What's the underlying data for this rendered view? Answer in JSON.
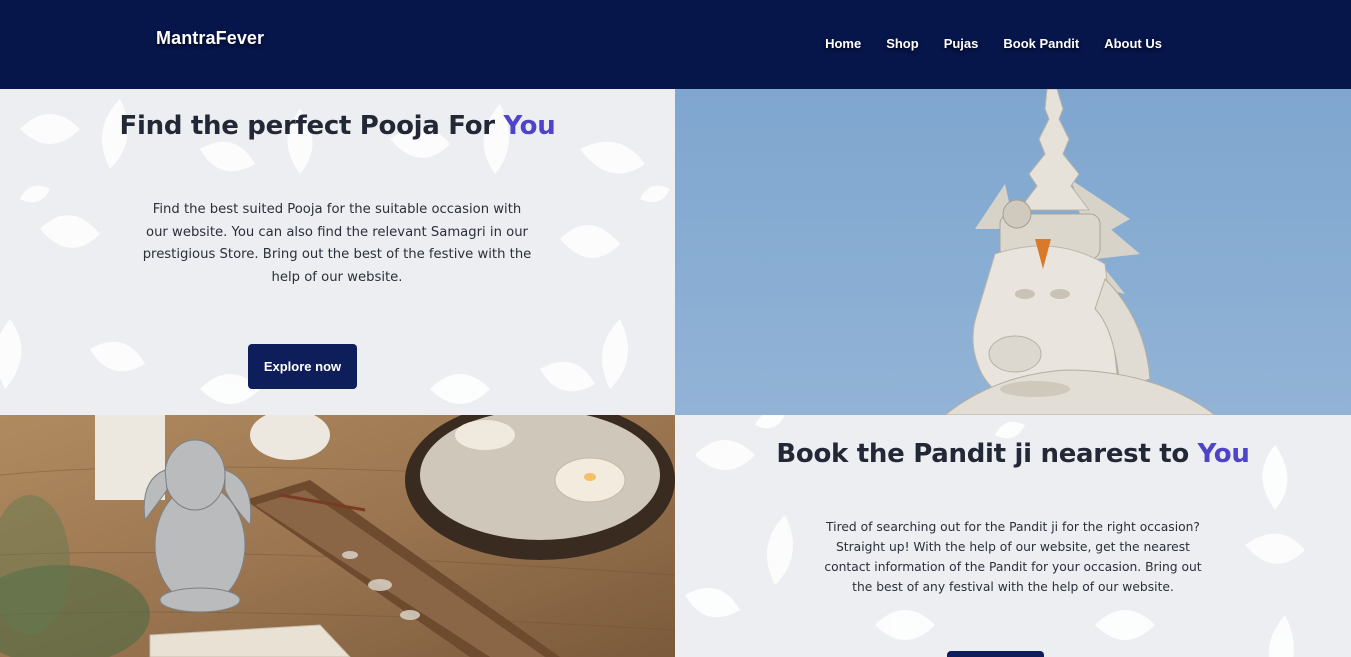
{
  "brand": "MantraFever",
  "nav": [
    "Home",
    "Shop",
    "Pujas",
    "Book Pandit",
    "About Us"
  ],
  "hero": {
    "title_main": "Find the perfect Pooja For ",
    "title_accent": "You",
    "body": "Find the best suited Pooja for the suitable occasion with our website. You can also find the relevant Samagri in our prestigious Store. Bring out the best of the festive with the help of our website.",
    "cta": "Explore now"
  },
  "pandit": {
    "title_main": "Book the Pandit ji nearest to ",
    "title_accent": "You",
    "body": "Tired of searching out for the Pandit ji for the right occasion? Straight up! With the help of our website, get the nearest contact information of the Pandit for your occasion. Bring out the best of any festival with the help of our website."
  },
  "colors": {
    "navbar": "#06154a",
    "accent": "#4f43c9",
    "button": "#0e1e5a"
  },
  "icons": [
    "hanuman-statue-image",
    "ganesha-incense-image"
  ]
}
